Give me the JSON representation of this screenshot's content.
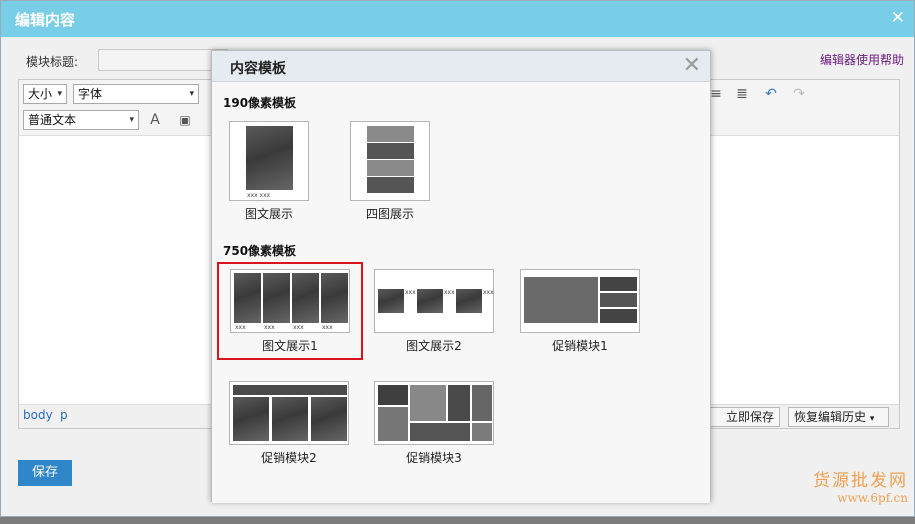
{
  "dialog": {
    "title": "编辑内容",
    "title_label": "模块标题:",
    "help_link": "编辑器使用帮助",
    "save_button": "保存"
  },
  "editor": {
    "size_select": "大小",
    "font_select": "字体",
    "format_select": "普通文本",
    "path": [
      "body",
      "p"
    ],
    "save_now": "立即保存",
    "restore_history": "恢复编辑历史"
  },
  "modal": {
    "title": "内容模板",
    "section_190": "190像素模板",
    "section_750": "750像素模板",
    "templates_190": [
      {
        "label": "图文展示",
        "tag": "xxx xxx"
      },
      {
        "label": "四图展示"
      }
    ],
    "templates_750": [
      {
        "label": "图文展示1",
        "selected": true,
        "tags": [
          "xxx",
          "xxx",
          "xxx",
          "xxx"
        ]
      },
      {
        "label": "图文展示2",
        "tags": [
          "xxx",
          "xxx",
          "xxx"
        ]
      },
      {
        "label": "促销模块1"
      },
      {
        "label": "促销模块2"
      },
      {
        "label": "促销模块3"
      }
    ]
  },
  "watermark": {
    "text": "货源批发网",
    "url": "www.6pf.cn"
  },
  "colors": {
    "header": "#78cde7",
    "save_button": "#2f86c8",
    "selected_border": "#d9141b",
    "help_link": "#6b1a7e"
  }
}
